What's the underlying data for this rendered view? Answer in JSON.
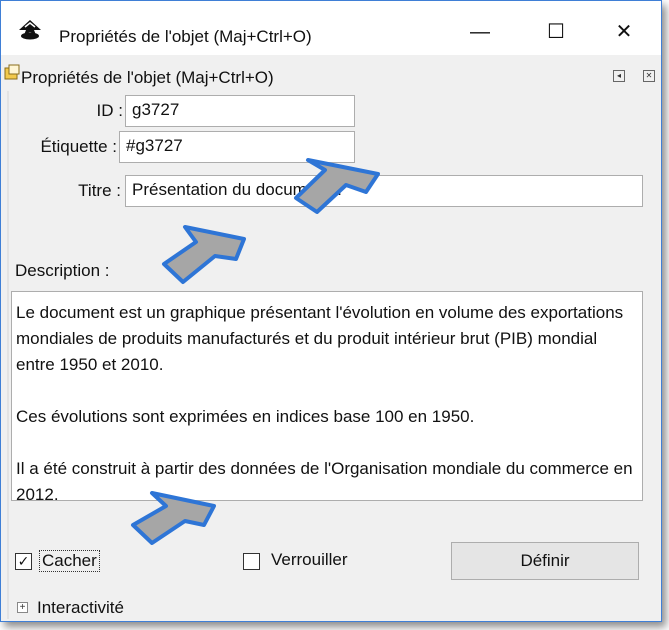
{
  "window": {
    "title": "Propriétés de l'objet (Maj+Ctrl+O)",
    "controls": {
      "minimize": "—",
      "maximize": "☐",
      "close": "✕"
    }
  },
  "dock": {
    "title": "Propriétés de l'objet (Maj+Ctrl+O)",
    "btn_left": "◂",
    "btn_close": "✕"
  },
  "form": {
    "id_label": "ID :",
    "id_value": "g3727",
    "etiquette_label": "Étiquette :",
    "etiquette_value": "#g3727",
    "titre_label": "Titre :",
    "titre_value": "Présentation du document ?",
    "description_label": "Description :",
    "description_paragraphs": [
      "Le document est un graphique présentant l'évolution en volume des exportations mondiales de produits manufacturés et du produit intérieur brut (PIB) mondial entre 1950 et 2010.",
      "Ces évolutions sont exprimées en indices base 100 en 1950.",
      "Il a été construit à partir des données de l'Organisation mondiale du commerce en 2012."
    ]
  },
  "options": {
    "cacher_label": "Cacher",
    "cacher_checked": true,
    "verrouiller_label": "Verrouiller",
    "verrouiller_checked": false,
    "definir_label": "Définir"
  },
  "interactivite": {
    "label": "Interactivité",
    "expander": "+"
  },
  "colors": {
    "window_border": "#3f7fd6",
    "annotation_arrow_fill": "#a6a6a6",
    "annotation_arrow_outline": "#2e75d6"
  }
}
